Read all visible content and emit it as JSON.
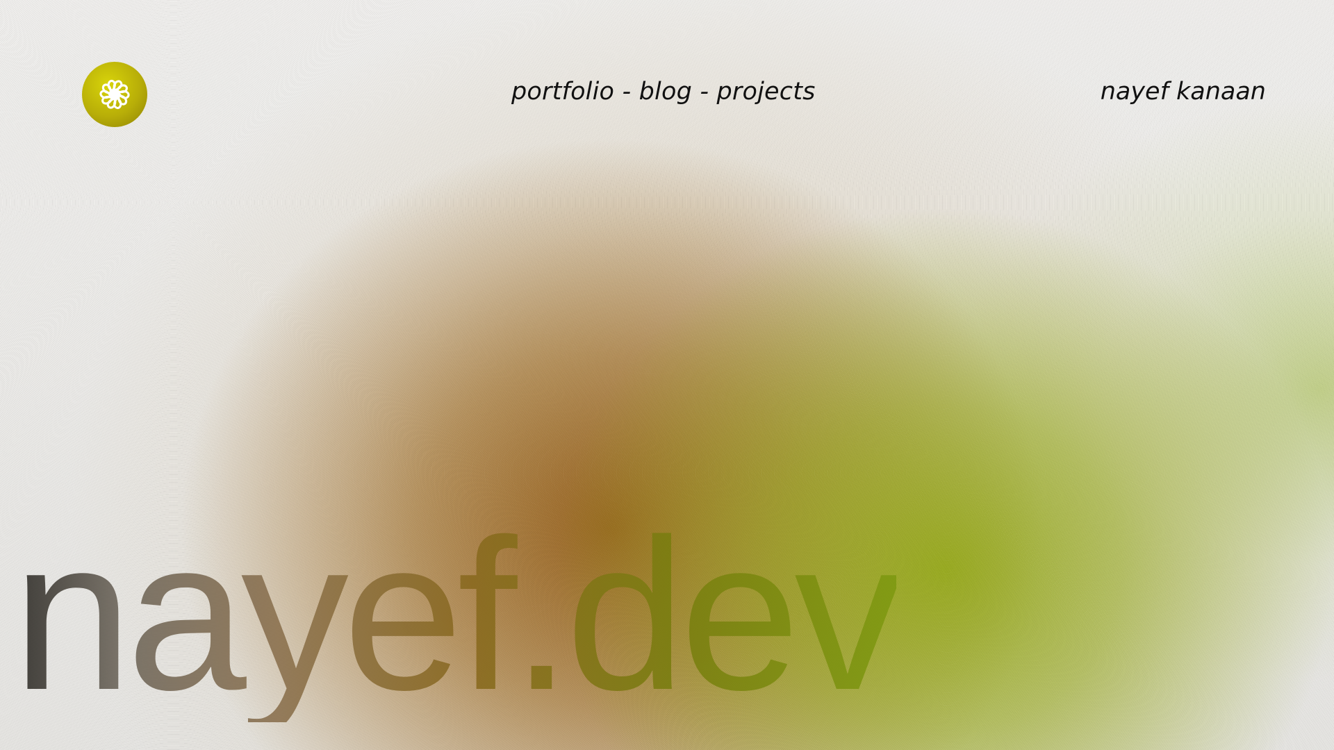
{
  "header": {
    "logo_icon": "flower-swirl-icon",
    "logo_color": "#c2b808",
    "nav": [
      {
        "label": "portfolio"
      },
      {
        "label": "blog"
      },
      {
        "label": "projects"
      }
    ],
    "separator": " - ",
    "author": "nayef kanaan"
  },
  "hero": {
    "title": "nayef.dev"
  },
  "colors": {
    "background": "#ecebe9",
    "brown": "#965f19",
    "olive": "#96aa19",
    "text": "#111111"
  }
}
